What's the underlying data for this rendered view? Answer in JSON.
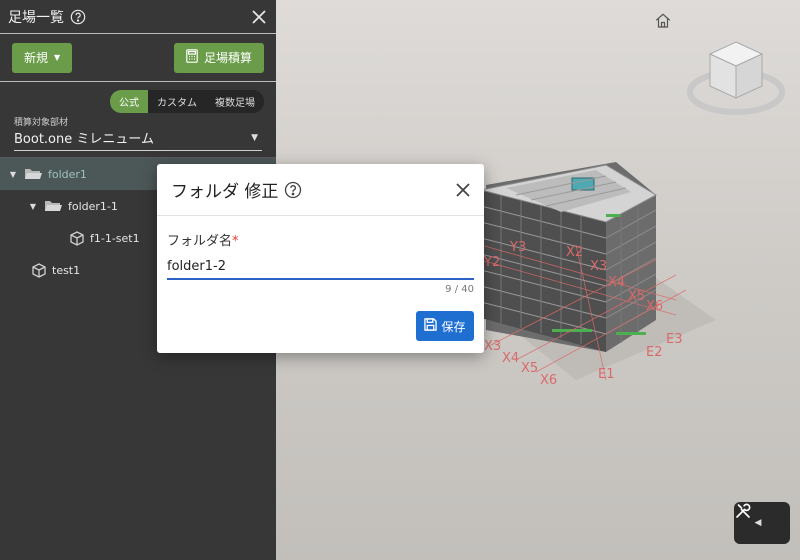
{
  "panel": {
    "title": "足場一覧",
    "new_button": "新規",
    "estimate_button": "足場積算",
    "tabs": [
      "公式",
      "カスタム",
      "複数足場"
    ],
    "active_tab": "公式",
    "target_label": "積算対象部材",
    "target_value": "Boot.one ミレニューム"
  },
  "tree": {
    "items": [
      {
        "label": "folder1",
        "type": "folder",
        "expanded": true,
        "selected": true
      },
      {
        "label": "folder1-1",
        "type": "folder",
        "expanded": true
      },
      {
        "label": "f1-1-set1",
        "type": "set"
      },
      {
        "label": "test1",
        "type": "set"
      }
    ]
  },
  "dialog": {
    "title": "フォルダ 修正",
    "field_label": "フォルダ名",
    "required_mark": "*",
    "field_value": "folder1-2",
    "counter": "9 / 40",
    "save_button": "保存"
  },
  "viewer": {
    "grid_labels": [
      "Y3",
      "Y2",
      "X2",
      "X3",
      "X4",
      "X5",
      "X6",
      "X3",
      "X4",
      "X5",
      "X6",
      "E3",
      "E2",
      "E1",
      "Y2",
      "Y3",
      "E"
    ]
  },
  "colors": {
    "accent_green": "#6a9c4a",
    "primary_blue": "#1f6fd1",
    "panel_bg": "#373737",
    "grid_red": "#d96a6a"
  }
}
